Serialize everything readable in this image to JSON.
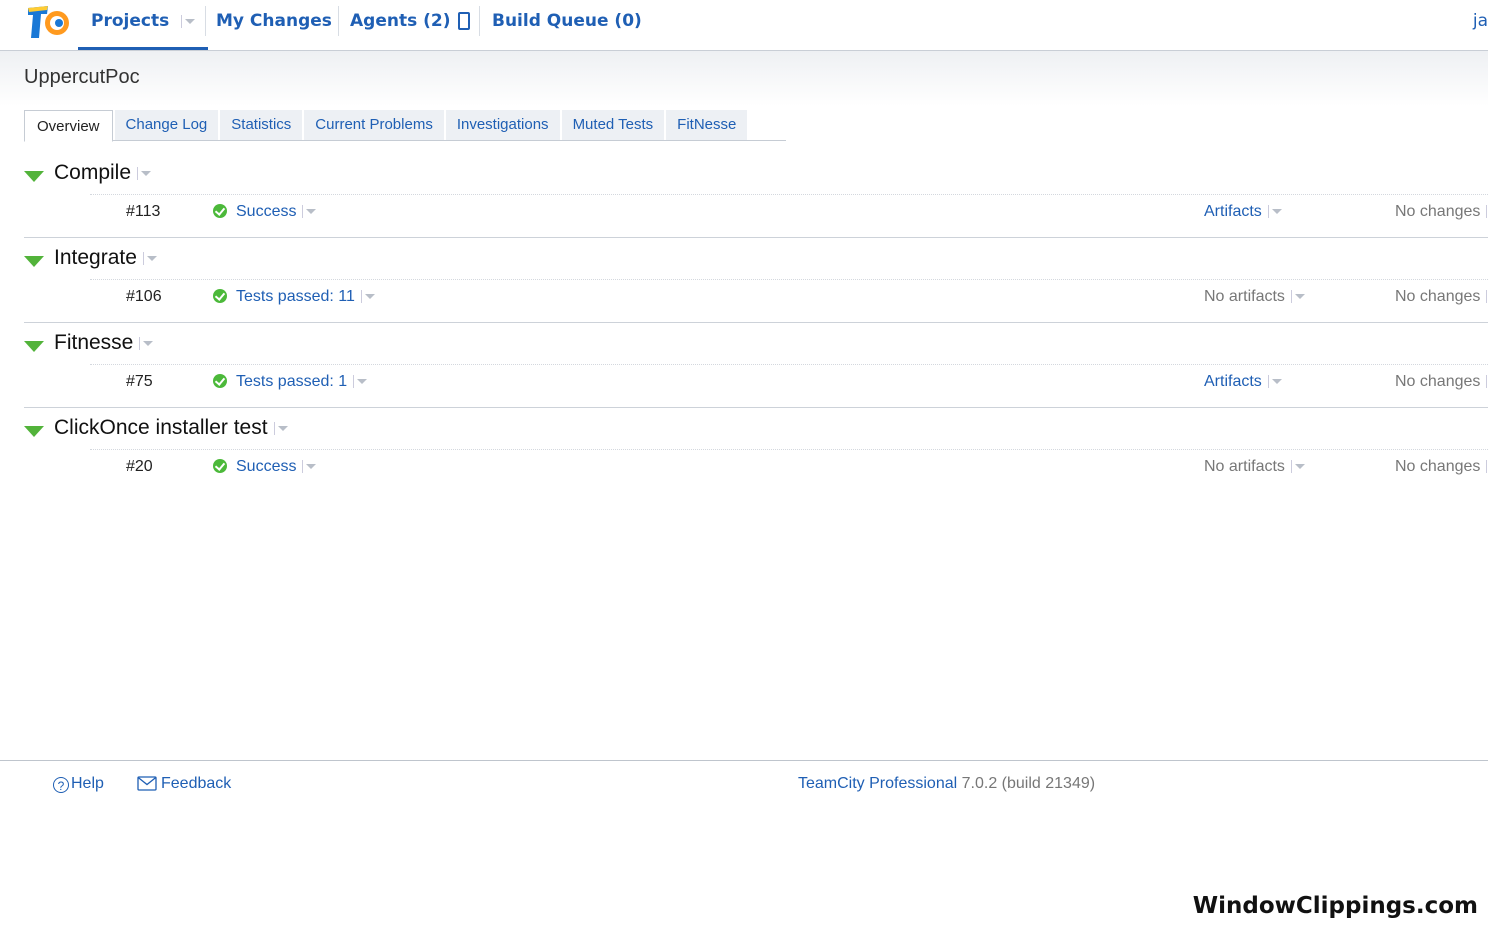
{
  "nav": {
    "projects": "Projects",
    "my_changes": "My Changes",
    "agents": "Agents (2)",
    "build_queue": "Build Queue (0)",
    "user_stub": "ja"
  },
  "project": {
    "title": "UppercutPoc"
  },
  "tabs": [
    {
      "label": "Overview"
    },
    {
      "label": "Change Log"
    },
    {
      "label": "Statistics"
    },
    {
      "label": "Current Problems"
    },
    {
      "label": "Investigations"
    },
    {
      "label": "Muted Tests"
    },
    {
      "label": "FitNesse"
    }
  ],
  "build_types": [
    {
      "name": "Compile",
      "build_number": "#113",
      "status": "Success",
      "artifacts": "Artifacts",
      "changes": "No changes"
    },
    {
      "name": "Integrate",
      "build_number": "#106",
      "status": "Tests passed: 11",
      "artifacts": "No artifacts",
      "changes": "No changes"
    },
    {
      "name": "Fitnesse",
      "build_number": "#75",
      "status": "Tests passed: 1",
      "artifacts": "Artifacts",
      "changes": "No changes"
    },
    {
      "name": "ClickOnce installer test",
      "build_number": "#20",
      "status": "Success",
      "artifacts": "No artifacts",
      "changes": "No changes"
    }
  ],
  "footer": {
    "help": "Help",
    "feedback": "Feedback",
    "product": "TeamCity Professional",
    "version": "7.0.2",
    "build": "(build 21349)"
  },
  "watermark": "WindowClippings.com",
  "colors": {
    "link": "#1f5fb4",
    "success": "#4cb93a",
    "expand_triangle": "#52b33a"
  },
  "icons": [
    "teamcity-logo-icon",
    "dropdown-arrow-icon",
    "agent-status-icon",
    "expand-triangle-icon",
    "success-check-icon",
    "help-icon",
    "mail-icon"
  ]
}
